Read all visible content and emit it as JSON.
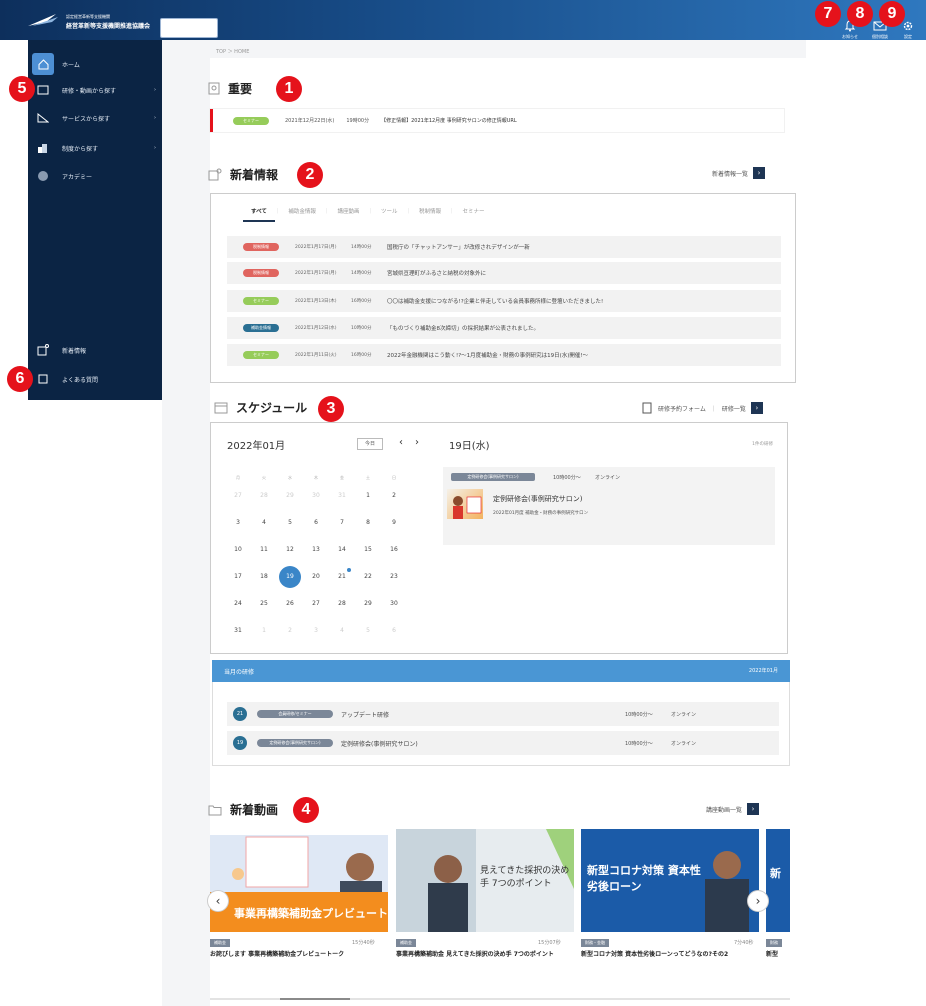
{
  "header": {
    "logo_sub": "認定経営革新等支援機関",
    "logo_main": "経営革新等支援機関推進協議会",
    "search_placeholder": "",
    "icons": [
      {
        "name": "bell-icon",
        "label": "お知らせ"
      },
      {
        "name": "mail-icon",
        "label": "個別相談"
      },
      {
        "name": "gear-icon",
        "label": "設定"
      }
    ]
  },
  "markers": [
    "1",
    "2",
    "3",
    "4",
    "5",
    "6",
    "7",
    "8",
    "9"
  ],
  "sidebar": {
    "items": [
      {
        "label": "ホーム",
        "icon": "home-icon"
      },
      {
        "label": "研修・動画から探す",
        "icon": "video-icon"
      },
      {
        "label": "サービスから探す",
        "icon": "service-icon"
      },
      {
        "label": "制度から探す",
        "icon": "building-icon"
      },
      {
        "label": "アカデミー",
        "icon": "academy-icon"
      }
    ],
    "bottom_items": [
      {
        "label": "新着情報",
        "icon": "news-icon"
      },
      {
        "label": "よくある質問",
        "icon": "faq-icon"
      }
    ],
    "arrow": "›"
  },
  "breadcrumb": "TOP ＞ HOME",
  "important": {
    "title": "重要",
    "row": {
      "tag": "セミナー",
      "date": "2021年12月22日(水)",
      "time": "19時00分",
      "text": "【修正情報】2021年12月度 事例研究サロンの修正情報URL"
    }
  },
  "news": {
    "title": "新着情報",
    "more": "新着情報一覧",
    "more_arrow": "›",
    "tabs": [
      "すべて",
      "補助金情報",
      "講座動画",
      "ツール",
      "税制情報",
      "セミナー"
    ],
    "sep": "｜",
    "rows": [
      {
        "tag": "税制情報",
        "tag_color": "red",
        "date": "2022年1月17日(月)",
        "time": "14時00分",
        "title": "国税庁の「チャットアンサー」が改修されデザインが一新"
      },
      {
        "tag": "税制情報",
        "tag_color": "red",
        "date": "2022年1月17日(月)",
        "time": "14時00分",
        "title": "宮城県亘理町がふるさと納税の対象外に"
      },
      {
        "tag": "セミナー",
        "tag_color": "green",
        "date": "2022年1月13日(木)",
        "time": "16時00分",
        "title": "〇〇は補助金支援につながる!?企業と伴走している会員事務所様に登壇いただきました!"
      },
      {
        "tag": "補助金情報",
        "tag_color": "dark",
        "date": "2022年1月12日(水)",
        "time": "10時00分",
        "title": "「ものづくり補助金8次締切」の採択結果が公表されました。"
      },
      {
        "tag": "セミナー",
        "tag_color": "green",
        "date": "2022年1月11日(火)",
        "time": "16時00分",
        "title": "2022年金融機関はこう動く!?〜1月度補助金・財務の事例研究は19日(水)開催!〜"
      }
    ]
  },
  "schedule": {
    "title": "スケジュール",
    "form_link": "研修予約フォーム",
    "list_link": "研修一覧",
    "sep": "｜",
    "more_arrow": "›",
    "month": "2022年01月",
    "today_btn": "今日",
    "prev": "‹",
    "next": "›",
    "weekdays": [
      "月",
      "火",
      "水",
      "木",
      "金",
      "土",
      "日"
    ],
    "weeks": [
      [
        "27",
        "28",
        "29",
        "30",
        "31",
        "1",
        "2"
      ],
      [
        "3",
        "4",
        "5",
        "6",
        "7",
        "8",
        "9"
      ],
      [
        "10",
        "11",
        "12",
        "13",
        "14",
        "15",
        "16"
      ],
      [
        "17",
        "18",
        "19",
        "20",
        "21",
        "22",
        "23"
      ],
      [
        "24",
        "25",
        "26",
        "27",
        "28",
        "29",
        "30"
      ],
      [
        "31",
        "1",
        "2",
        "3",
        "4",
        "5",
        "6"
      ]
    ],
    "day_head": "19日(水)",
    "day_count": "1件の研修",
    "event": {
      "tag": "定例研修会(事例研究サロン)",
      "time": "10時00分〜",
      "place": "オンライン",
      "title": "定例研修会(事例研究サロン)",
      "sub": "2022年01月度 補助金・財務の事例研究サロン"
    }
  },
  "month_list": {
    "title": "当月の研修",
    "month": "2022年01月",
    "rows": [
      {
        "day": "21",
        "tag": "会員研修/セミナー",
        "title": "アップデート研修",
        "time": "10時00分〜",
        "place": "オンライン"
      },
      {
        "day": "19",
        "tag": "定例研修会(事例研究サロン)",
        "title": "定例研修会(事例研究サロン)",
        "time": "10時00分〜",
        "place": "オンライン"
      }
    ]
  },
  "videos": {
    "title": "新着動画",
    "more": "講座動画一覧",
    "more_arrow": "›",
    "prev": "‹",
    "next": "›",
    "items": [
      {
        "category": "補助金",
        "duration": "15分40秒",
        "title": "お詫びします 事業再構築補助金プレビュートーク",
        "thumb_text": "事業再構築補助金プレビュートーク"
      },
      {
        "category": "補助金",
        "duration": "15分07秒",
        "title": "事業再構築補助金 見えてきた採択の決め手 7つのポイント",
        "thumb_text": "見えてきた採択の決め手 7つのポイント"
      },
      {
        "category": "財務・金融",
        "duration": "7分40秒",
        "title": "新型コロナ対策 資本性劣後ローンってどうなの?その2",
        "thumb_text": "新型コロナ対策 資本性劣後ローン"
      },
      {
        "category": "財務",
        "duration": "",
        "title": "新型",
        "thumb_text": "新"
      }
    ]
  },
  "colors": {
    "header": "#174b86",
    "sidebar": "#0b2444",
    "accent": "#3a86c8",
    "marker": "#e5121b"
  }
}
